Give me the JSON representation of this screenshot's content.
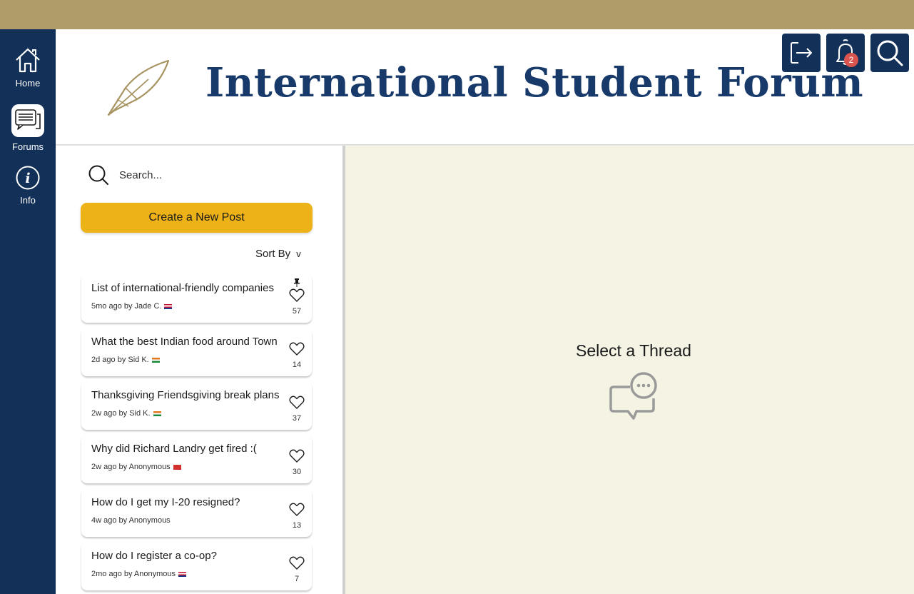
{
  "nav": {
    "items": [
      {
        "label": "Home",
        "icon": "home-icon"
      },
      {
        "label": "Forums",
        "icon": "chat-bubbles-icon"
      },
      {
        "label": "Info",
        "icon": "info-icon"
      }
    ]
  },
  "header": {
    "title": "International Student Forum",
    "logo_icon": "quill-pen-icon",
    "notifications_count": "2"
  },
  "search": {
    "placeholder": "Search..."
  },
  "create_post_label": "Create a New Post",
  "sort": {
    "label": "Sort By",
    "chevron": "v"
  },
  "threads": [
    {
      "title": "List of international-friendly companies",
      "meta": "5mo ago by Jade C.",
      "flag": "usa",
      "likes": "57",
      "pinned": true
    },
    {
      "title": "What the best Indian food around Town",
      "meta": "2d ago by Sid K.",
      "flag": "india",
      "likes": "14",
      "pinned": false
    },
    {
      "title": "Thanksgiving Friendsgiving break plans",
      "meta": "2w ago by Sid K.",
      "flag": "india",
      "likes": "37",
      "pinned": false
    },
    {
      "title": "Why did Richard Landry get fired :(",
      "meta": "2w ago by Anonymous",
      "flag": "red",
      "likes": "30",
      "pinned": false
    },
    {
      "title": "How do I get my I-20 resigned?",
      "meta": "4w ago by Anonymous",
      "flag": "",
      "likes": "13",
      "pinned": false
    },
    {
      "title": "How do I register a co-op?",
      "meta": "2mo ago by Anonymous",
      "flag": "usa",
      "likes": "7",
      "pinned": false
    }
  ],
  "empty_state": {
    "title": "Select a Thread",
    "icon": "message-bubble-icon"
  },
  "colors": {
    "topbar": "#b09c68",
    "navy": "#123058",
    "title_blue": "#173a6a",
    "accent_yellow": "#ecb217",
    "panel_bg": "#f5f3e3",
    "badge_red": "#d9534f"
  }
}
